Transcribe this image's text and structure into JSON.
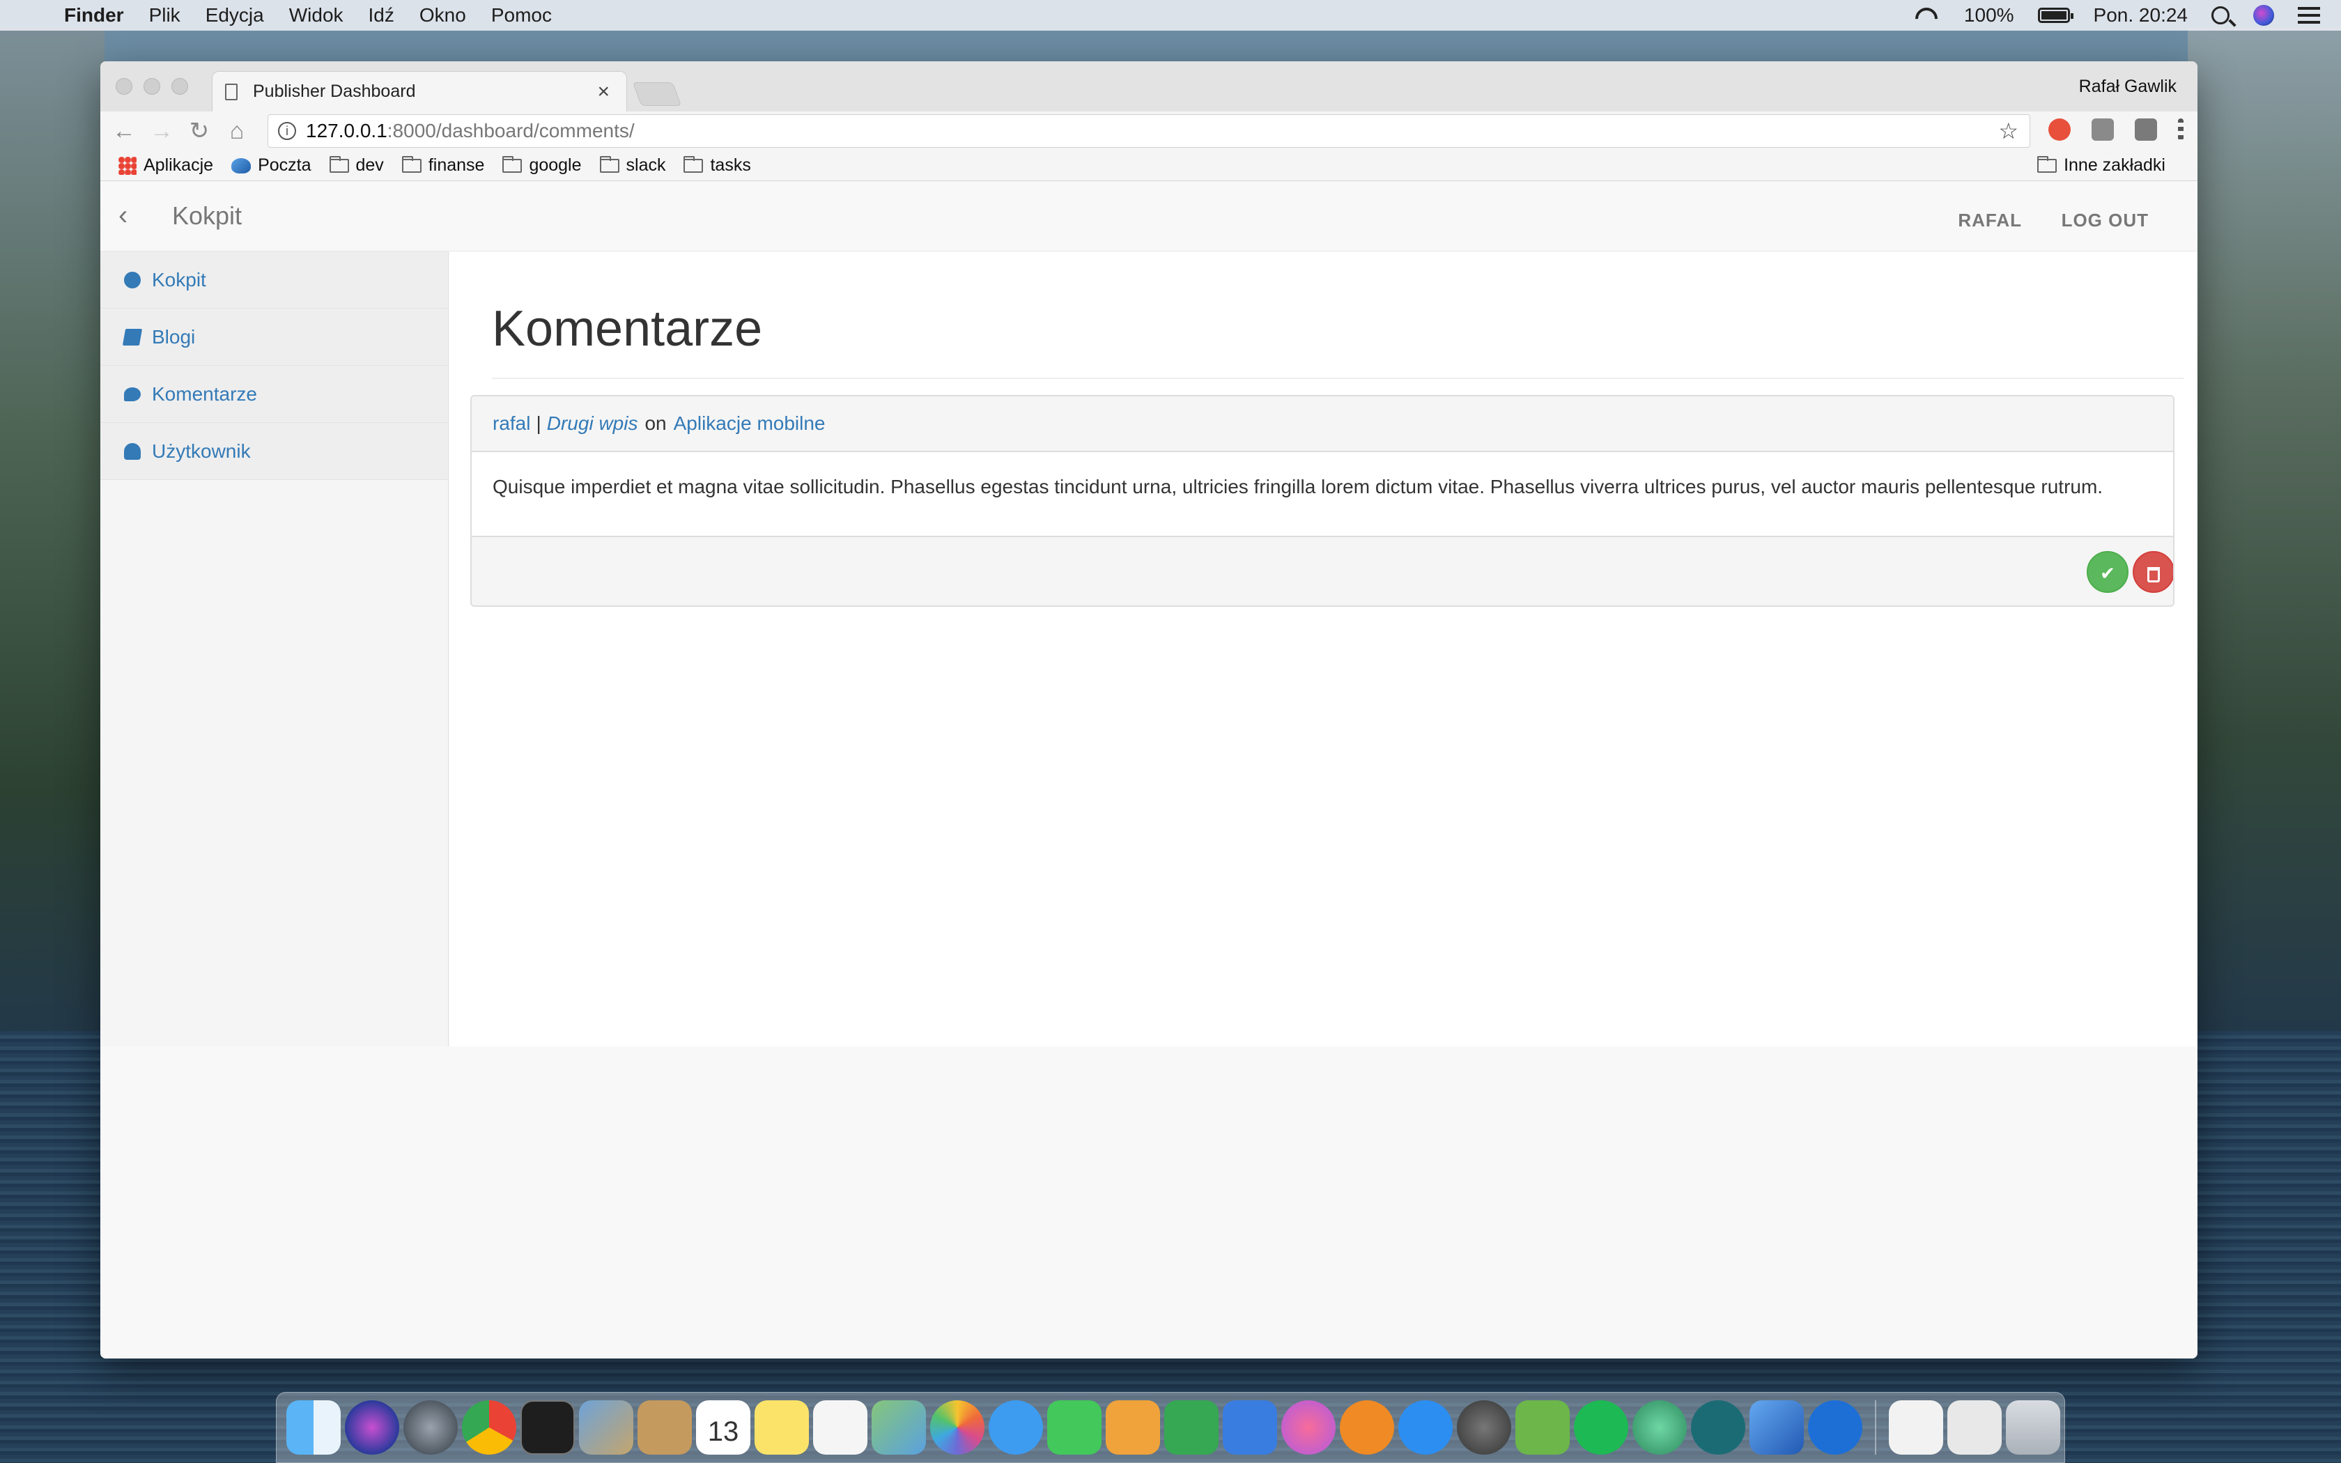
{
  "menubar": {
    "app_name": "Finder",
    "menus": [
      "Plik",
      "Edycja",
      "Widok",
      "Idź",
      "Okno",
      "Pomoc"
    ],
    "battery": "100%",
    "clock": "Pon. 20:24"
  },
  "browser": {
    "tab_title": "Publisher Dashboard",
    "tab_close": "×",
    "profile_name": "Rafał Gawlik",
    "url_host": "127.0.0.1",
    "url_rest": ":8000/dashboard/comments/",
    "bookmarks": {
      "apps": "Aplikacje",
      "mail": "Poczta",
      "folders": [
        "dev",
        "finanse",
        "google",
        "slack",
        "tasks"
      ],
      "other": "Inne zakładki"
    }
  },
  "navbar": {
    "back": "‹",
    "brand": "Kokpit",
    "user_link": "RAFAL",
    "logout_link": "LOG OUT"
  },
  "sidebar": {
    "items": [
      {
        "label": "Kokpit",
        "icon": "dashboard-icon"
      },
      {
        "label": "Blogi",
        "icon": "book-icon"
      },
      {
        "label": "Komentarze",
        "icon": "comment-icon"
      },
      {
        "label": "Użytkownik",
        "icon": "user-icon"
      }
    ]
  },
  "main": {
    "title": "Komentarze",
    "comment": {
      "author": "rafal",
      "separator": "|",
      "post": "Drugi wpis",
      "on": "on",
      "blog": "Aplikacje mobilne",
      "body": "Quisque imperdiet et magna vitae sollicitudin. Phasellus egestas tincidunt urna, ultricies fringilla lorem dictum vitae. Phasellus viverra ultrices purus, vel auctor mauris pellentesque rutrum.",
      "approve_icon": "✔",
      "delete_icon": "🗑"
    }
  },
  "colors": {
    "link": "#337ab7",
    "approve": "#5cb85c",
    "delete": "#d9534f"
  },
  "dock": {
    "icons": [
      "finder-icon",
      "siri-icon",
      "launchpad-icon",
      "chrome-icon",
      "terminal-icon",
      "preview-icon",
      "notes-icon",
      "calendar-icon",
      "stickies-icon",
      "reminders-icon",
      "maps-icon",
      "photos-icon",
      "messages-icon",
      "facetime-icon",
      "pages-icon",
      "numbers-icon",
      "keynote-icon",
      "itunes-icon",
      "books-icon",
      "appstore-icon",
      "system-preferences-icon",
      "android-studio-icon",
      "spotify-icon",
      "atom-icon",
      "gitkraken-icon",
      "xcode-icon",
      "sourcetree-icon",
      "document-icon",
      "calendar-doc-icon",
      "trash-icon"
    ],
    "calendar_day": "13"
  }
}
